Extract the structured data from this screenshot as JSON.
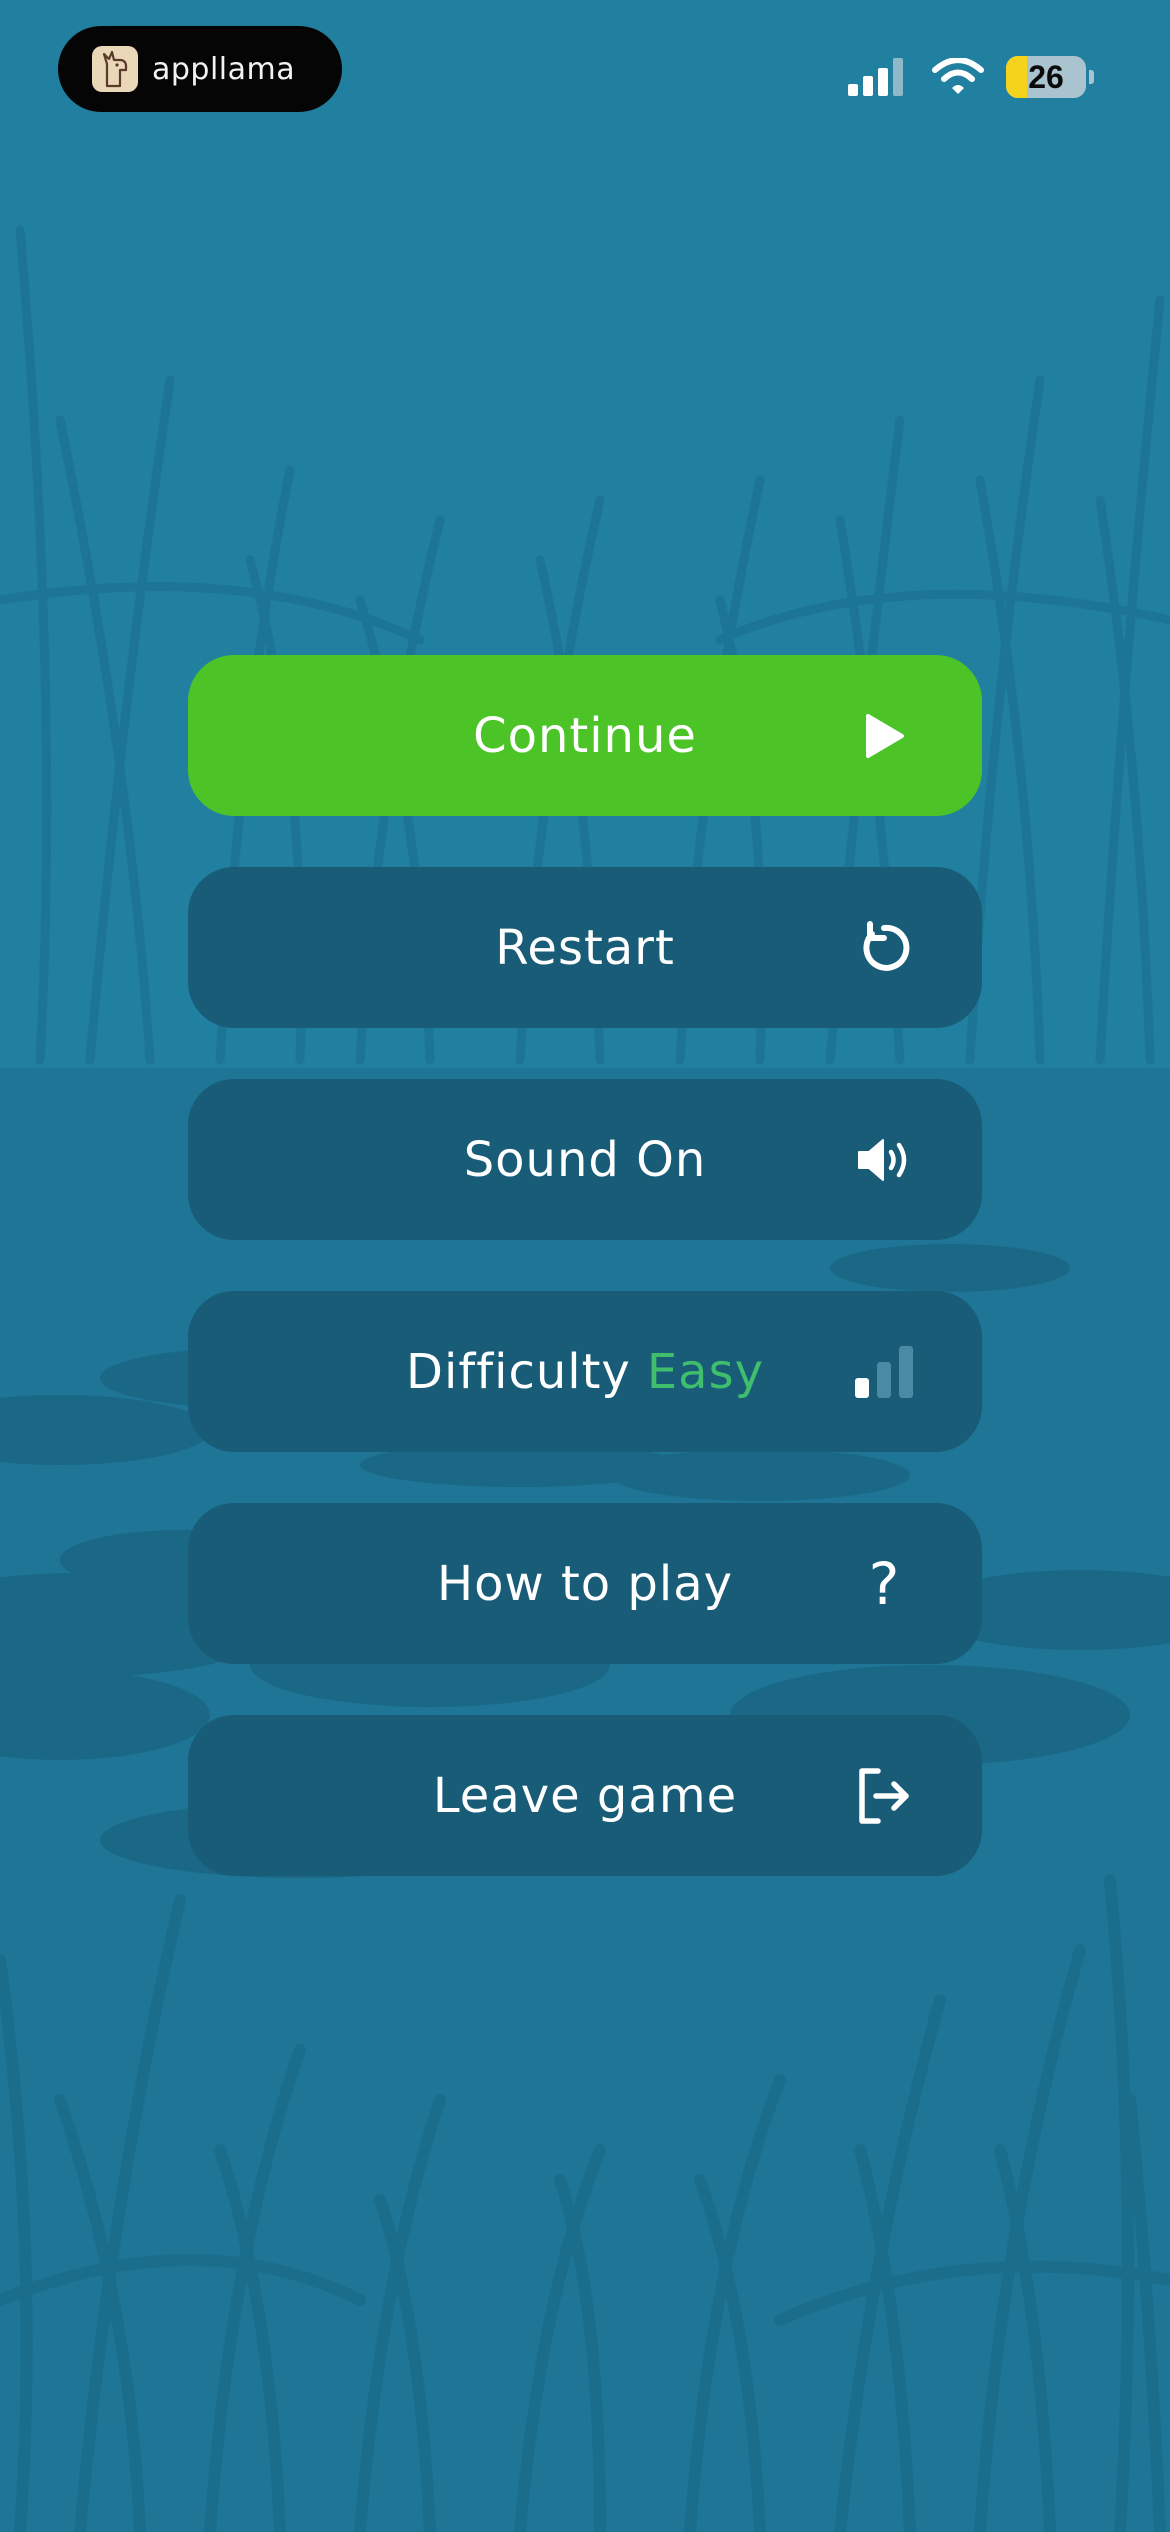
{
  "status_bar": {
    "brand_name": "appllama",
    "battery_level": "26",
    "battery_fraction": 0.26,
    "icons": [
      "signal-icon",
      "wifi-icon",
      "battery-icon"
    ]
  },
  "menu": {
    "continue": {
      "label": "Continue",
      "icon": "play-icon"
    },
    "restart": {
      "label": "Restart",
      "icon": "restart-icon"
    },
    "sound": {
      "label": "Sound On",
      "icon": "speaker-icon"
    },
    "difficulty": {
      "label": "Difficulty",
      "value": "Easy",
      "icon": "difficulty-bars-icon"
    },
    "how_to_play": {
      "label": "How to play",
      "icon": "question-icon"
    },
    "leave": {
      "label": "Leave game",
      "icon": "exit-icon"
    }
  },
  "colors": {
    "background": "#1f7d9d",
    "primary_button": "#4cc427",
    "secondary_button": "#185c77",
    "difficulty_value": "#3fbf6c"
  }
}
